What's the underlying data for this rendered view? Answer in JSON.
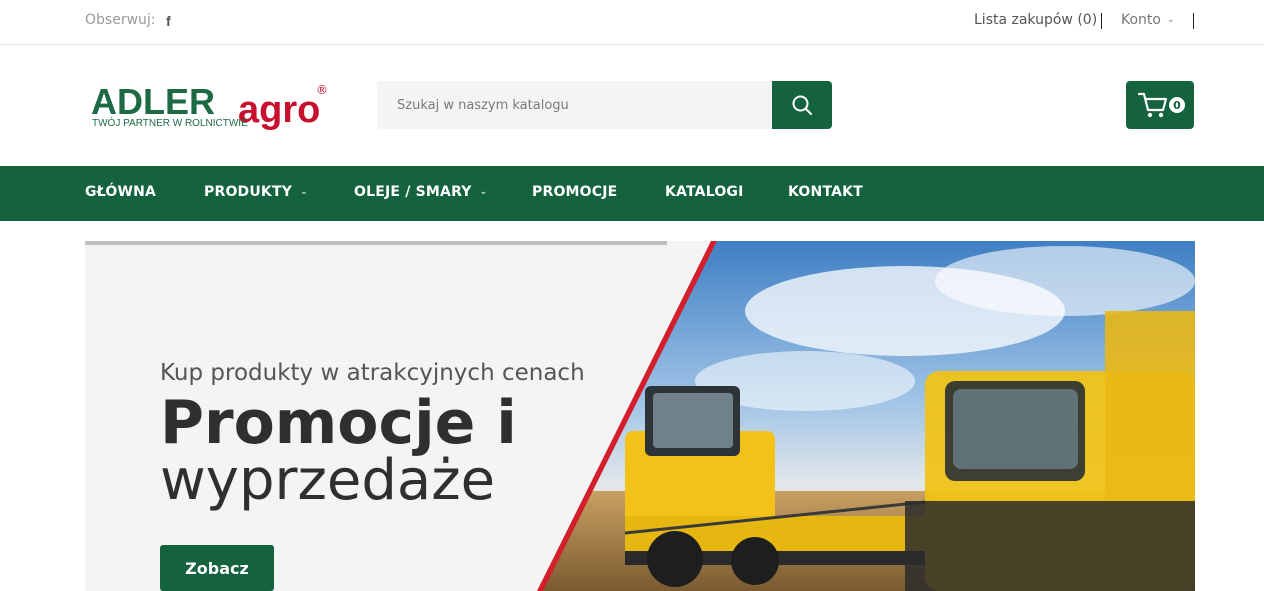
{
  "topbar": {
    "follow_label": "Obserwuj:",
    "facebook_glyph": "f",
    "shopping_list": "Lista zakupów (0)",
    "account": "Konto"
  },
  "header": {
    "logo": {
      "brand_left": "ADLER",
      "brand_right": "agro",
      "registered": "®",
      "tagline": "TWÓJ PARTNER W ROLNICTWIE"
    },
    "search": {
      "placeholder": "Szukaj w naszym katalogu"
    },
    "cart": {
      "count": "0"
    }
  },
  "nav": {
    "items": [
      {
        "label": "GŁÓWNA",
        "has_dropdown": false
      },
      {
        "label": "PRODUKTY",
        "has_dropdown": true
      },
      {
        "label": "OLEJE / SMARY",
        "has_dropdown": true
      },
      {
        "label": "PROMOCJE",
        "has_dropdown": false
      },
      {
        "label": "KATALOGI",
        "has_dropdown": false
      },
      {
        "label": "KONTAKT",
        "has_dropdown": false
      }
    ]
  },
  "hero": {
    "subtitle": "Kup produkty w atrakcyjnych cenach",
    "title_line1": "Promocje i",
    "title_line2": "wyprzedaże",
    "button": "Zobacz"
  },
  "colors": {
    "brand_green": "#14623e",
    "logo_red": "#c8102e",
    "hero_bg": "#f4f4f4",
    "stripe_red": "#d21f2b"
  }
}
